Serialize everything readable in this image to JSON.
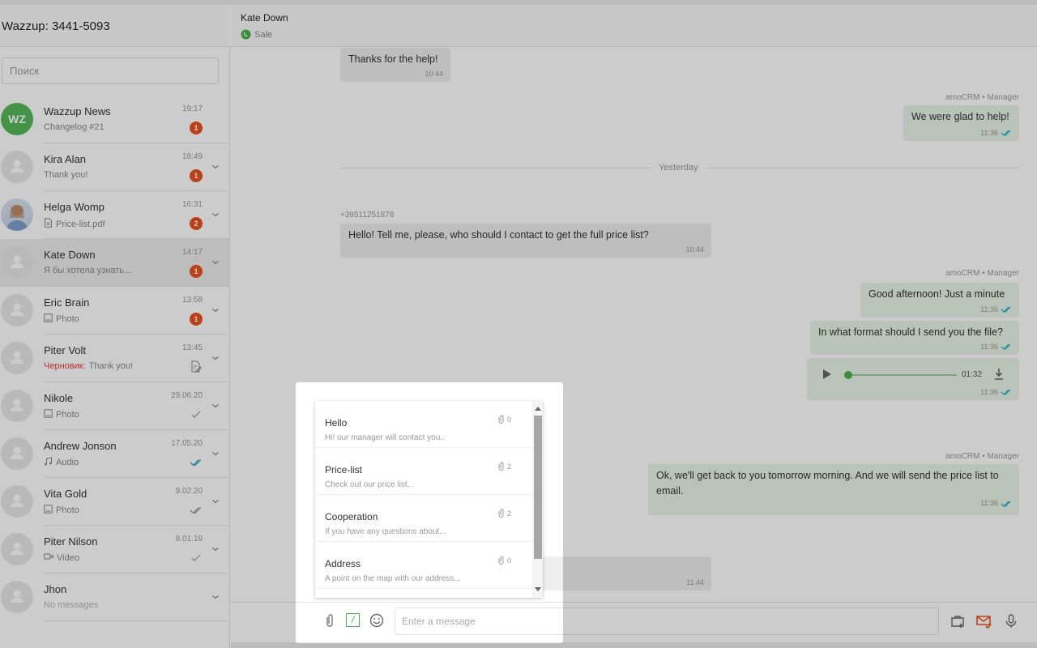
{
  "account": {
    "title": "Wazzup: 3441-5093"
  },
  "search": {
    "placeholder": "Поиск"
  },
  "chats": [
    {
      "name": "Wazzup News",
      "time": "19:17",
      "preview": "Changelog #21",
      "badge": "1",
      "avatar": "WZ",
      "chevron": false
    },
    {
      "name": "Kira Alan",
      "time": "18:49",
      "preview": "Thank you!",
      "badge": "1"
    },
    {
      "name": "Helga Womp",
      "time": "16:31",
      "preview": "Price-list.pdf",
      "preview_icon": "file-icon",
      "badge": "2",
      "avatar_photo": true
    },
    {
      "name": "Kate Down",
      "time": "14:17",
      "preview": "Я бы хотела узнать...",
      "badge": "1",
      "selected": true
    },
    {
      "name": "Eric Brain",
      "time": "13:58",
      "preview": "Photo",
      "preview_icon": "photo-icon",
      "badge": "1"
    },
    {
      "name": "Piter Volt",
      "time": "13:45",
      "draft_label": "Черновик:",
      "preview": "Thank you!",
      "status": "draft"
    },
    {
      "name": "Nikole",
      "time": "29.06.20",
      "preview": "Photo",
      "preview_icon": "photo-icon",
      "status": "sent"
    },
    {
      "name": "Andrew Jonson",
      "time": "17.05.20",
      "preview": "Audio",
      "preview_icon": "audio-icon",
      "status": "read"
    },
    {
      "name": "Vita Gold",
      "time": "9.02.20",
      "preview": "Photo",
      "preview_icon": "photo-icon",
      "status": "delivered"
    },
    {
      "name": "Piter Nilson",
      "time": "8.01.19",
      "preview": "Video",
      "preview_icon": "video-icon",
      "status": "sent"
    },
    {
      "name": "Jhon",
      "time": "",
      "preview": "No messages",
      "empty": true
    }
  ],
  "conversation": {
    "contact": "Kate Down",
    "channel": "Sale",
    "sender_label": "amoCRM • Manager",
    "day_divider": "Yesterday",
    "phone": "+39511251878",
    "messages": [
      {
        "text": "Thanks for the help!",
        "time": "10:44"
      },
      {
        "text": "We were glad to help!",
        "time": "11:36"
      },
      {
        "text": "Hello! Tell me, please, who should I contact to get the full price list?",
        "time": "10:44"
      },
      {
        "text": "Good afternoon! Just a minute",
        "time": "11:36"
      },
      {
        "text": "In what format should I send you the file?",
        "time": "11:36"
      },
      {
        "audio_duration": "01:32",
        "time": "11:36",
        "progress": 0
      },
      {
        "text": "Ok, we'll get back to you tomorrow morning. And we will send the price list to email.",
        "time": "11:36"
      },
      {
        "text": "",
        "time": "11:44"
      }
    ]
  },
  "templates": [
    {
      "title": "Hello",
      "desc": "Hi! our manager will contact you..",
      "attachments": "0"
    },
    {
      "title": "Price-list",
      "desc": "Check out our price list...",
      "attachments": "2"
    },
    {
      "title": "Cooperation",
      "desc": "If you have any questions about...",
      "attachments": "2"
    },
    {
      "title": "Address",
      "desc": "A point on the map with our address...",
      "attachments": "0"
    }
  ],
  "composer": {
    "placeholder": "Enter a message",
    "template_glyph": "/"
  },
  "colors": {
    "accent": "#4caf50",
    "badge": "#e8501e",
    "read_check": "#26a8c9",
    "draft": "#e53935"
  }
}
